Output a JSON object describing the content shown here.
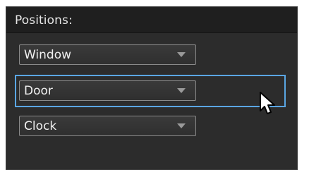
{
  "panel": {
    "title": "Positions:"
  },
  "dropdowns": [
    {
      "value": "Window"
    },
    {
      "value": "Door"
    },
    {
      "value": "Clock"
    }
  ],
  "selected": {
    "index": 1
  },
  "colors": {
    "panel_bg": "#2c2c2c",
    "header_bg": "#1f1f1f",
    "selection_outline": "#5aa6e3",
    "text": "#f0f0f0"
  },
  "icons": {
    "dropdown_caret": "chevron-down-icon",
    "cursor": "mouse-cursor-icon"
  }
}
